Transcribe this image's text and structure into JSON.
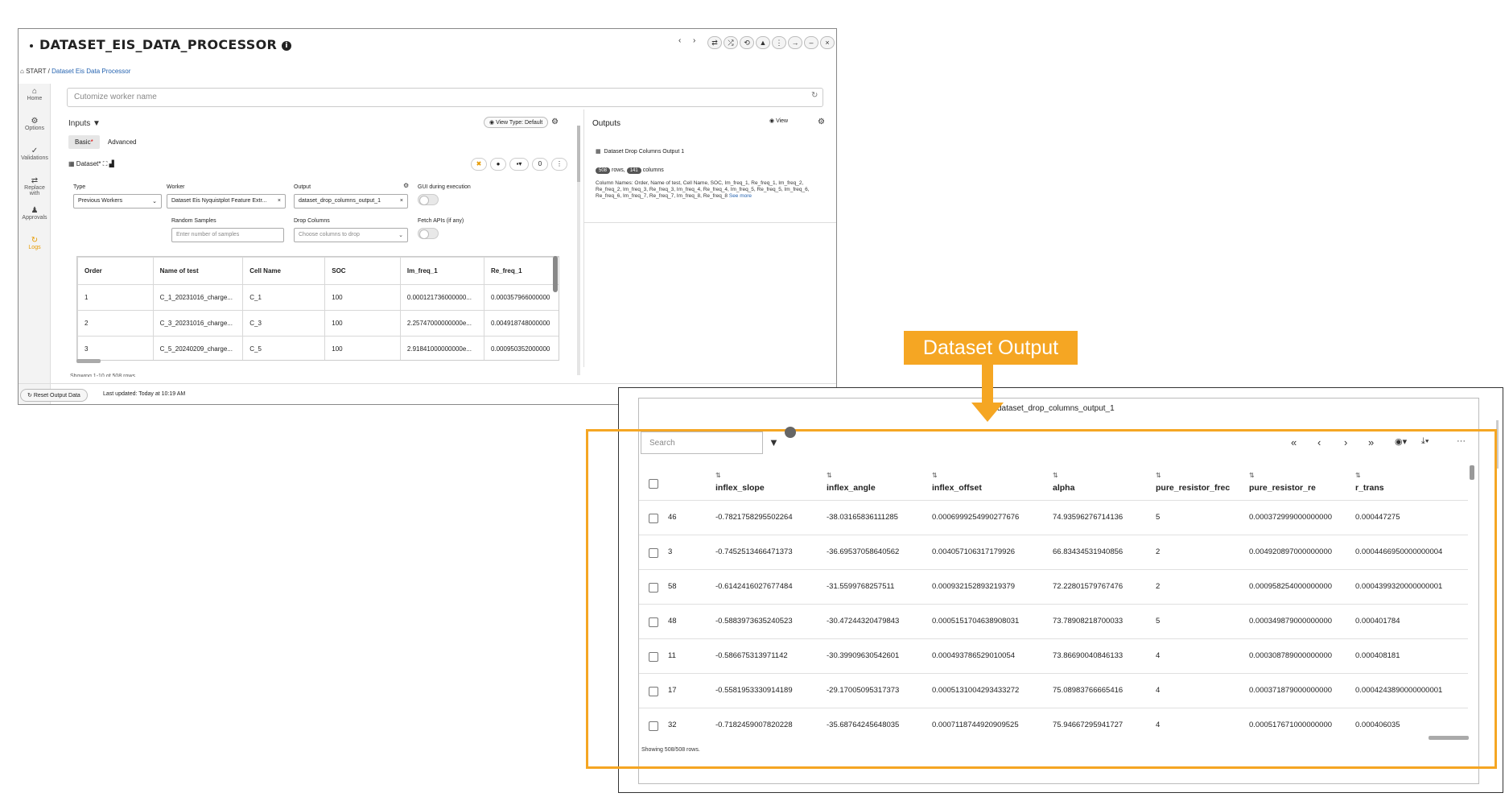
{
  "main_window": {
    "title": "DATASET_EIS_DATA_PROCESSOR",
    "nav": {
      "back": "‹",
      "forward": "›"
    },
    "toolbar_pills": [
      "⇄",
      "⤮",
      "⟲",
      "▲",
      "⋮",
      "→",
      "–",
      "×"
    ],
    "breadcrumb": {
      "home": "START",
      "separator": "/",
      "current": "Dataset Eis Data Processor"
    },
    "sidebar": [
      {
        "icon": "⌂",
        "label": "Home"
      },
      {
        "icon": "⚙",
        "label": "Options"
      },
      {
        "icon": "✓",
        "label": "Validations"
      },
      {
        "icon": "⇄",
        "label": "Replace with"
      },
      {
        "icon": "♟",
        "label": "Approvals"
      },
      {
        "icon": "↻",
        "label": "Logs"
      }
    ],
    "worker_name_placeholder": "Cutomize worker name",
    "inputs": {
      "label": "Inputs",
      "view_type_btn": "View Type: Default",
      "tabs": {
        "basic": "Basic",
        "basic_req": "*",
        "advanced": "Advanced"
      },
      "dataset_label": "Dataset",
      "dataset_req": "*",
      "round_buttons": [
        "✖",
        "●",
        "▪▾",
        "0",
        "⋮"
      ],
      "fields": {
        "type_label": "Type",
        "type_value": "Previous Workers",
        "worker_label": "Worker",
        "worker_value": "Dataset Eis Nyquistplot Feature Extr...",
        "output_label": "Output",
        "output_value": "dataset_drop_columns_output_1",
        "gui_label": "GUI during execution",
        "random_label": "Random Samples",
        "random_placeholder": "Enter number of samples",
        "drop_label": "Drop Columns",
        "drop_placeholder": "Choose columns to drop",
        "fetch_label": "Fetch APIs (if any)"
      },
      "grid": {
        "columns": [
          "Order",
          "Name of test",
          "Cell Name",
          "SOC",
          "Im_freq_1",
          "Re_freq_1"
        ],
        "rows": [
          [
            "1",
            "C_1_20231016_charge...",
            "C_1",
            "100",
            "0.000121736000000...",
            "0.000357966000000"
          ],
          [
            "2",
            "C_3_20231016_charge...",
            "C_3",
            "100",
            "2.25747000000000e...",
            "0.004918748000000"
          ],
          [
            "3",
            "C_5_20240209_charge...",
            "C_5",
            "100",
            "2.91841000000000e...",
            "0.000950352000000"
          ]
        ],
        "showing": "Showing 1-10 of 508 rows"
      }
    },
    "outputs": {
      "label": "Outputs",
      "view_btn": "View",
      "item_name": "Dataset Drop Columns Output 1",
      "rows_count": "508",
      "rows_label": "rows,",
      "cols_count": "141",
      "cols_label": "columns",
      "column_names": "Column Names: Order, Name of test, Cell Name, SOC, Im_freq_1, Re_freq_1, Im_freq_2, Re_freq_2, Im_freq_3, Re_freq_3, Im_freq_4, Re_freq_4, Im_freq_5, Re_freq_5, Im_freq_6, Re_freq_6, Im_freq_7, Re_freq_7, Im_freq_8, Re_freq_8",
      "see_more": "See more"
    },
    "footer": {
      "reset_btn": "Reset Output Data",
      "last_updated": "Last updated: Today at 10:19 AM"
    }
  },
  "callout": {
    "text": "Dataset Output",
    "color": "#f5a623"
  },
  "output_window": {
    "title": "dataset_drop_columns_output_1",
    "search_placeholder": "Search",
    "pagination": [
      "«",
      "‹",
      "›",
      "»"
    ],
    "view_icon": "◉▾",
    "download_icon": "⤓▾",
    "more_icon": "···",
    "columns": [
      "inflex_slope",
      "inflex_angle",
      "inflex_offset",
      "alpha",
      "pure_resistor_frec",
      "pure_resistor_re",
      "r_trans"
    ],
    "rows": [
      {
        "id": "46",
        "cells": [
          "-0.7821758295502264",
          "-38.03165836111285",
          "0.0006999254990277676",
          "74.93596276714136",
          "5",
          "0.000372999000000000",
          "0.000447275"
        ]
      },
      {
        "id": "3",
        "cells": [
          "-0.7452513466471373",
          "-36.69537058640562",
          "0.004057106317179926",
          "66.83434531940856",
          "2",
          "0.004920897000000000",
          "0.0004466950000000004"
        ]
      },
      {
        "id": "58",
        "cells": [
          "-0.6142416027677484",
          "-31.5599768257511",
          "0.000932152893219379",
          "72.22801579767476",
          "2",
          "0.000958254000000000",
          "0.0004399320000000001"
        ]
      },
      {
        "id": "48",
        "cells": [
          "-0.5883973635240523",
          "-30.47244320479843",
          "0.0005151704638908031",
          "73.78908218700033",
          "5",
          "0.000349879000000000",
          "0.000401784"
        ]
      },
      {
        "id": "11",
        "cells": [
          "-0.586675313971142",
          "-30.39909630542601",
          "0.000493786529010054",
          "73.86690040846133",
          "4",
          "0.000308789000000000",
          "0.000408181"
        ]
      },
      {
        "id": "17",
        "cells": [
          "-0.5581953330914189",
          "-29.17005095317373",
          "0.0005131004293433272",
          "75.08983766665416",
          "4",
          "0.000371879000000000",
          "0.0004243890000000001"
        ]
      },
      {
        "id": "32",
        "cells": [
          "-0.7182459007820228",
          "-35.68764245648035",
          "0.0007118744920909525",
          "75.94667295941727",
          "4",
          "0.000517671000000000",
          "0.000406035"
        ]
      }
    ],
    "showing": "Showing 508/508 rows."
  }
}
